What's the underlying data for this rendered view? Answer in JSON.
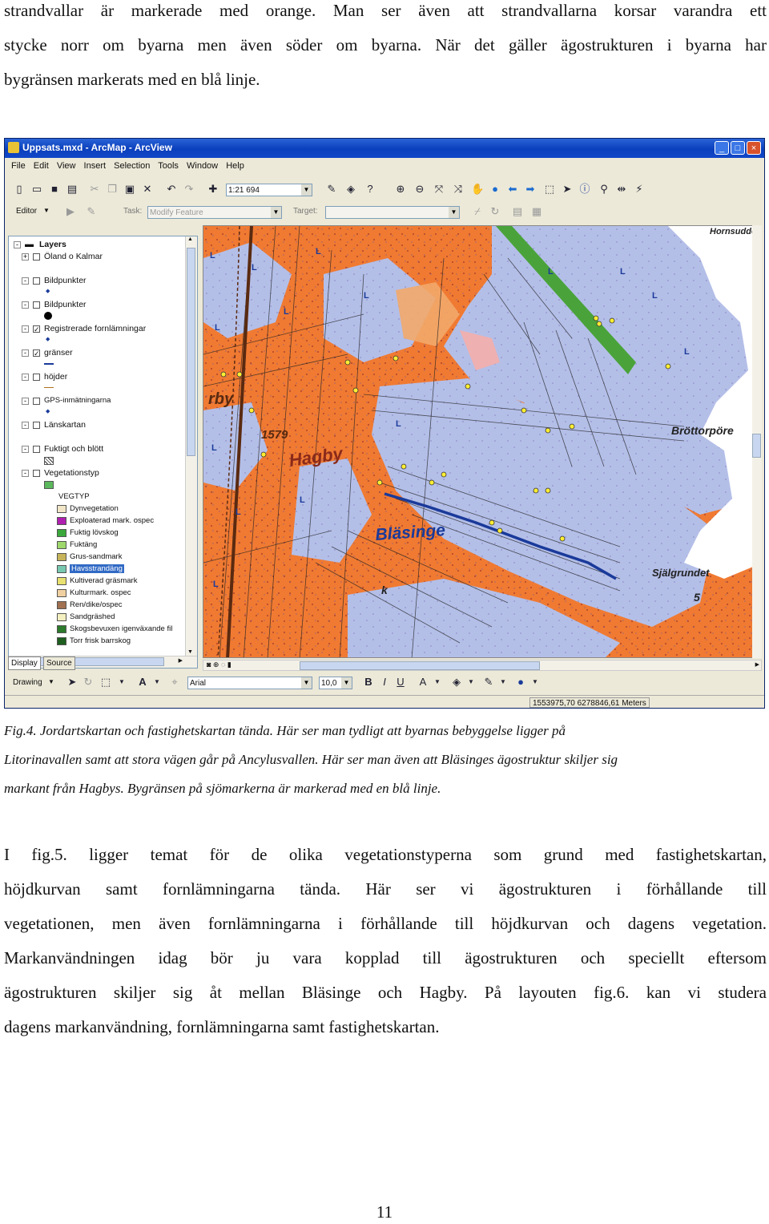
{
  "top_paragraph": {
    "lines": [
      "strandvallar är markerade med orange. Man ser även att strandvallarna korsar varandra ett",
      "stycke norr om byarna men även söder om byarna. När det gäller ägostrukturen i byarna har",
      "bygränsen markerats med en blå linje."
    ]
  },
  "window": {
    "title": "Uppsats.mxd - ArcMap - ArcView",
    "menu": [
      "File",
      "Edit",
      "View",
      "Insert",
      "Selection",
      "Tools",
      "Window",
      "Help"
    ],
    "scale": "1:21 694",
    "editor_label": "Editor",
    "task_label": "Task:",
    "task_value": "Modify Feature",
    "target_label": "Target:",
    "toc": {
      "root": "Layers",
      "layers": [
        "Öland o Kalmar",
        "Bildpunkter",
        "Bildpunkter",
        "Registrerade fornlämningar",
        "gränser",
        "höjder",
        "GPS-inmätningarna",
        "Länskartan",
        "Fuktigt och blött",
        "Vegetationstyp"
      ],
      "legend_header": "VEGTYP",
      "legend": [
        {
          "label": "Dynvegetation",
          "color": "#f2e6c8"
        },
        {
          "label": "Exploaterad mark. ospec",
          "color": "#b020b0"
        },
        {
          "label": "Fuktig lövskog",
          "color": "#3aa83a"
        },
        {
          "label": "Fuktäng",
          "color": "#9ed86c"
        },
        {
          "label": "Grus-sandmark",
          "color": "#c8b45a"
        },
        {
          "label": "Havsstrandäng",
          "color": "#78c8b0"
        },
        {
          "label": "Kultiverad gräsmark",
          "color": "#e8e070"
        },
        {
          "label": "Kulturmark. ospec",
          "color": "#f0d0a0"
        },
        {
          "label": "Ren/dike/ospec",
          "color": "#a07050"
        },
        {
          "label": "Sandgräshed",
          "color": "#f4f0c0"
        },
        {
          "label": "Skogsbevuxen igenväxande fil",
          "color": "#2c7a2c"
        },
        {
          "label": "Torr frisk barrskog",
          "color": "#1e5e1e"
        }
      ],
      "tabs": [
        "Display",
        "Source"
      ]
    },
    "map_labels": {
      "hagby": "Hagby",
      "blasinge": "Bläsinge",
      "number": "1579",
      "brottorp": "Bröttorpöre",
      "sjalgrundet": "Själgrundet",
      "depth": "5",
      "rby": "rby",
      "k": "k",
      "top_right": "Hornsudde"
    },
    "drawing_label": "Drawing",
    "font_name": "Arial",
    "font_size": "10,0",
    "coordinates": "1553975,70  6278846,61 Meters"
  },
  "caption": {
    "lines": [
      "Fig.4.   Jordartskartan   och   fastighetskartan   tända.   Här   ser   man   tydligt   att   byarnas   bebyggelse   ligger   på",
      "Litorinavallen samt att stora vägen går på Ancylusvallen. Här ser man även att Bläsinges ägostruktur skiljer sig",
      "markant från Hagbys. Bygränsen på sjömarkerna är markerad med en blå linje."
    ]
  },
  "bottom_paragraph": {
    "lines": [
      "I fig.5. ligger temat för de olika vegetationstyperna som grund med fastighetskartan,",
      "höjdkurvan samt fornlämningarna tända. Här ser vi ägostrukturen i förhållande till",
      "vegetationen, men även fornlämningarna i förhållande till höjdkurvan och dagens vegetation.",
      "Markanvändningen idag bör ju vara kopplad till ägostrukturen och speciellt eftersom",
      "ägostrukturen skiljer sig åt mellan Bläsinge och Hagby. På layouten fig.6. kan vi studera",
      "dagens markanvändning, fornlämningarna samt fastighetskartan."
    ]
  },
  "page_number": "11",
  "colors": {
    "orange": "#f07a32",
    "lightblue": "#b4bfe8",
    "sea": "#ffffff",
    "boundary": "#1a3a9a",
    "green_strip": "#4aa33a"
  }
}
